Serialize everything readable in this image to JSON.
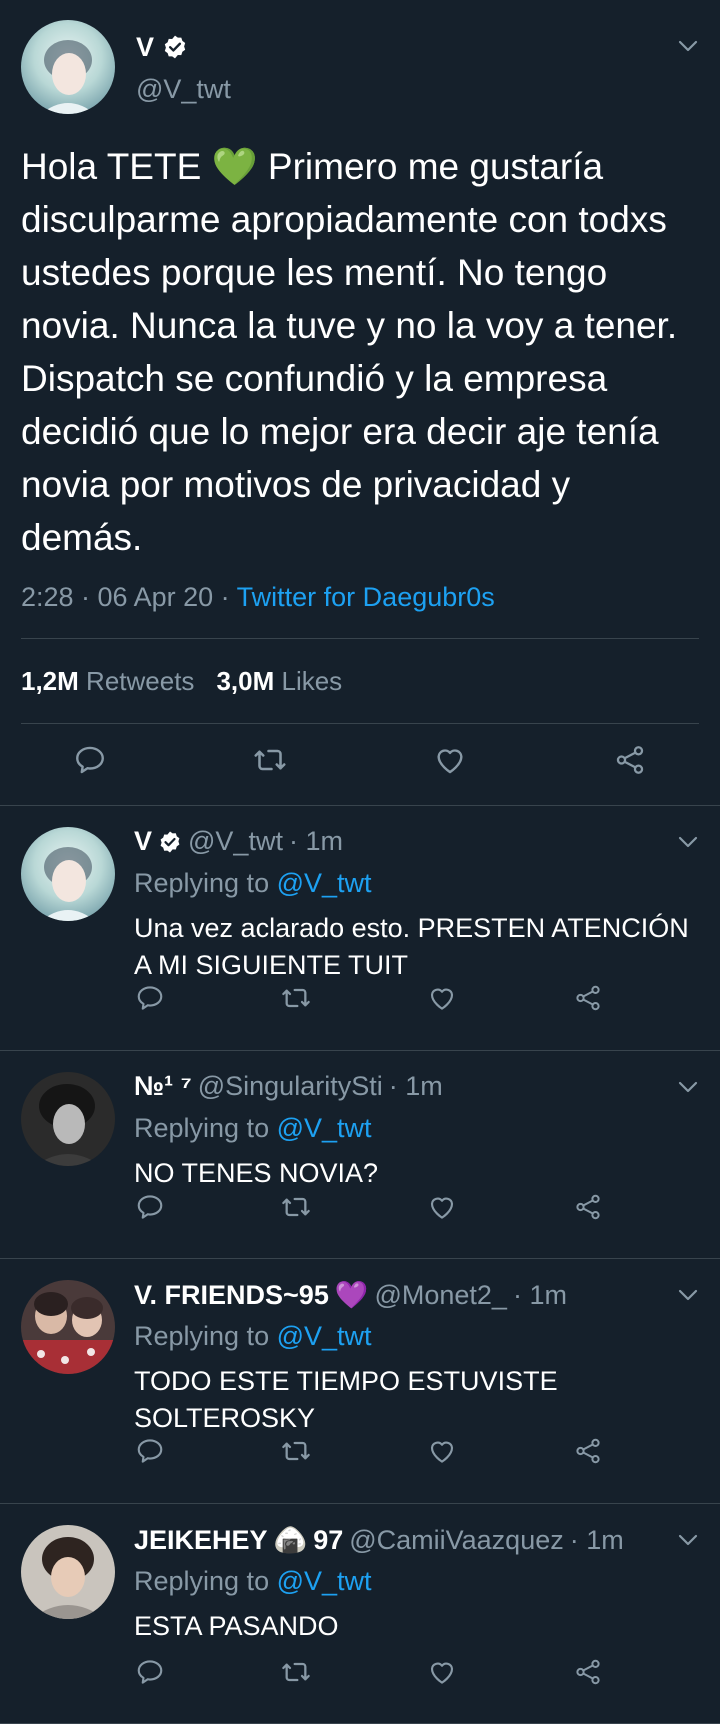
{
  "colors": {
    "background": "#15202b",
    "text": "#ffffff",
    "muted": "#8899a6",
    "link": "#1da1f2",
    "divider": "#38444d"
  },
  "main_tweet": {
    "name": "V",
    "handle": "@V_twt",
    "text_before": "Hola TETE ",
    "text_emoji": "💚",
    "text_after": " Primero me gustaría disculparme apropiadamente con todxs ustedes porque les mentí. No tengo novia. Nunca la tuve y no la voy a tener. Dispatch se confundió y la empresa decidió que lo mejor era decir aje tenía novia por motivos de privacidad y demás.",
    "timestamp": "2:28 · 06 Apr 20 · ",
    "source": "Twitter for Daegubr0s",
    "retweets_count": "1,2M",
    "retweets_label": "Retweets",
    "likes_count": "3,0M",
    "likes_label": "Likes"
  },
  "replies": [
    {
      "name": "V",
      "verified": true,
      "name_emoji": "",
      "name_suffix": "",
      "handle": "@V_twt",
      "time": "· 1m",
      "replying_label": "Replying to",
      "replying_to": "@V_twt",
      "text": "Una vez aclarado esto. PRESTEN ATENCIÓN A MI SIGUIENTE TUIT"
    },
    {
      "name": "№¹ ⁷",
      "verified": false,
      "name_emoji": "",
      "name_suffix": "",
      "handle": "@SingularitySti",
      "time": "· 1m",
      "replying_label": "Replying to",
      "replying_to": "@V_twt",
      "text": "NO TENES NOVIA?"
    },
    {
      "name": "V. FRIENDS~95",
      "verified": false,
      "name_emoji": "💜",
      "name_suffix": "",
      "handle": "@Monet2_",
      "time": "· 1m",
      "replying_label": "Replying to",
      "replying_to": "@V_twt",
      "text": "TODO ESTE TIEMPO ESTUVISTE SOLTEROSKY"
    },
    {
      "name": "JEIKEHEY",
      "verified": false,
      "name_emoji": "🍙",
      "name_suffix": "97",
      "handle": "@CamiiVaazquez",
      "time": "· 1m",
      "replying_label": "Replying to",
      "replying_to": "@V_twt",
      "text": "ESTA PASANDO"
    }
  ],
  "icons": [
    "verified-badge-icon",
    "chevron-down-icon",
    "reply-icon",
    "retweet-icon",
    "like-icon",
    "share-icon"
  ]
}
